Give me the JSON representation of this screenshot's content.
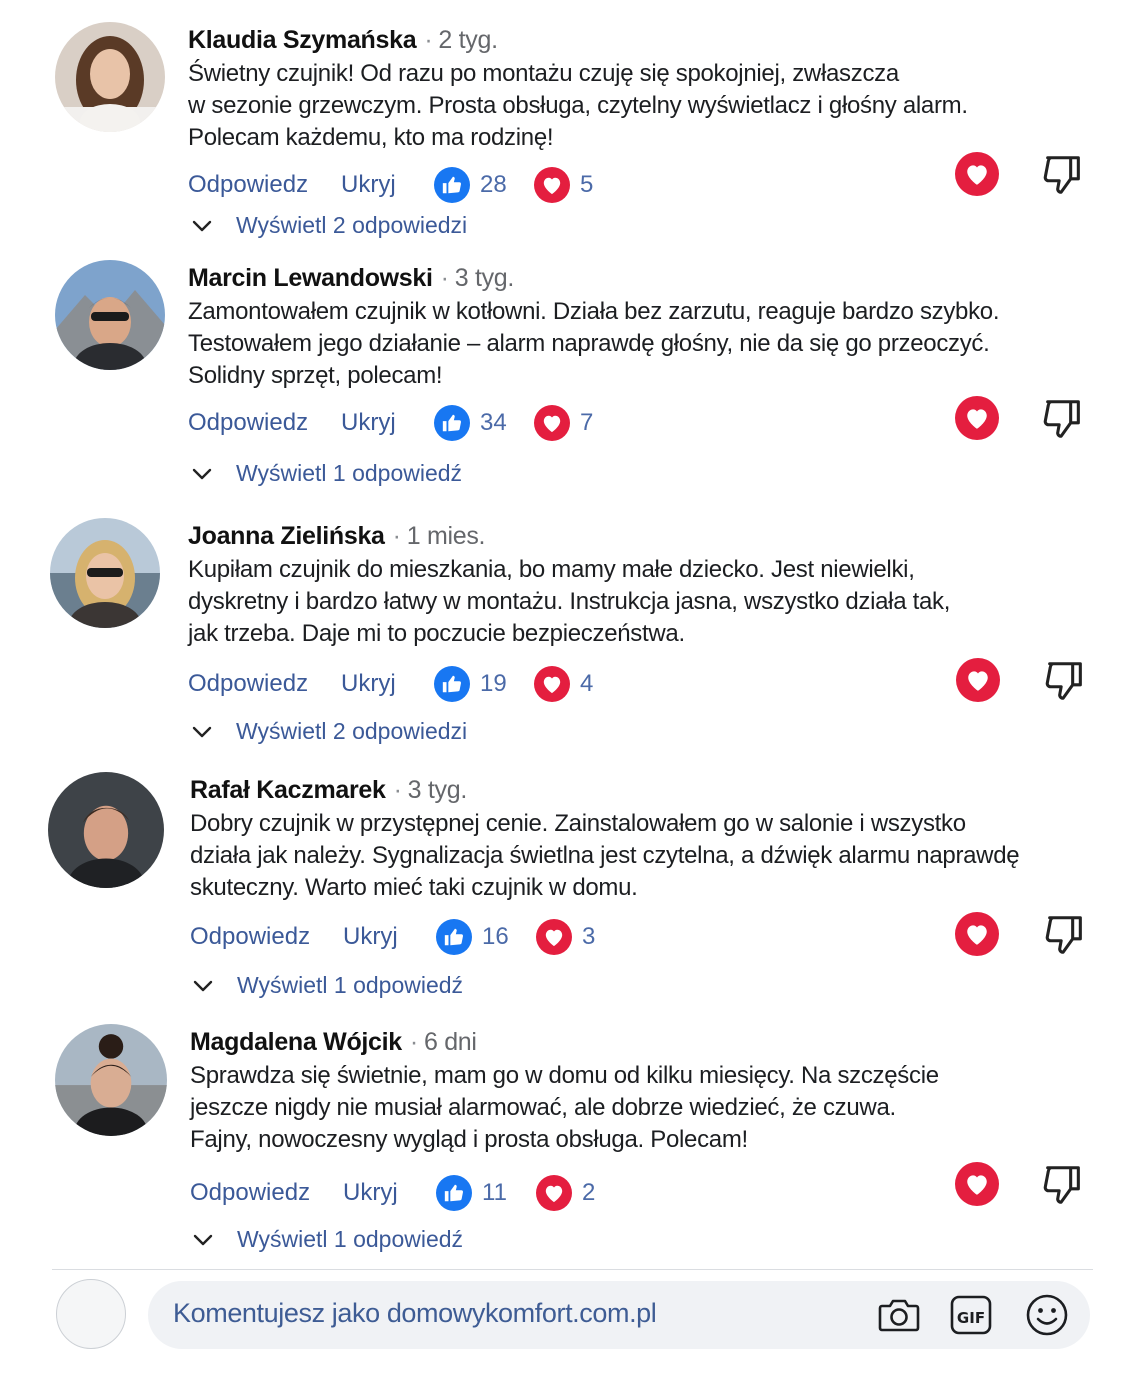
{
  "comments": [
    {
      "author": "Klaudia Szymańska",
      "time": "2 tyg.",
      "lines": [
        "Świetny czujnik! Od razu po montażu czuję się spokojniej, zwłaszcza",
        "w sezonie grzewczym. Prosta obsługa, czytelny wyświetlacz i głośny alarm.",
        "Polecam każdemu, kto ma rodzinę!"
      ],
      "reply_label": "Odpowiedz",
      "hide_label": "Ukryj",
      "likes": "28",
      "hearts": "5",
      "view_replies": "Wyświetl 2 odpowiedzi"
    },
    {
      "author": "Marcin Lewandowski",
      "time": "3 tyg.",
      "lines": [
        "Zamontowałem czujnik w kotłowni. Działa bez zarzutu, reaguje bardzo szybko.",
        "Testowałem jego działanie – alarm naprawdę głośny, nie da się go przeoczyć.",
        "Solidny sprzęt, polecam!"
      ],
      "reply_label": "Odpowiedz",
      "hide_label": "Ukryj",
      "likes": "34",
      "hearts": "7",
      "view_replies": "Wyświetl 1 odpowiedź"
    },
    {
      "author": "Joanna Zielińska",
      "time": "1 mies.",
      "lines": [
        "Kupiłam czujnik do mieszkania, bo mamy małe dziecko. Jest niewielki,",
        "dyskretny i bardzo łatwy w montażu. Instrukcja jasna, wszystko działa tak,",
        "jak trzeba. Daje mi to poczucie bezpieczeństwa."
      ],
      "reply_label": "Odpowiedz",
      "hide_label": "Ukryj",
      "likes": "19",
      "hearts": "4",
      "view_replies": "Wyświetl 2 odpowiedzi"
    },
    {
      "author": "Rafał Kaczmarek",
      "time": "3 tyg.",
      "lines": [
        "Dobry czujnik w przystępnej cenie. Zainstalowałem go w salonie i wszystko",
        "działa jak należy. Sygnalizacja świetlna jest czytelna, a dźwięk alarmu naprawdę",
        "skuteczny. Warto mieć taki czujnik w domu."
      ],
      "reply_label": "Odpowiedz",
      "hide_label": "Ukryj",
      "likes": "16",
      "hearts": "3",
      "view_replies": "Wyświetl 1 odpowiedź"
    },
    {
      "author": "Magdalena Wójcik",
      "time": "6 dni",
      "lines": [
        "Sprawdza się świetnie, mam go w domu od kilku miesięcy. Na szczęście",
        "jeszcze nigdy nie musiał alarmować, ale dobrze wiedzieć, że czuwa.",
        "Fajny, nowoczesny wygląd i prosta obsługa. Polecam!"
      ],
      "reply_label": "Odpowiedz",
      "hide_label": "Ukryj",
      "likes": "11",
      "hearts": "2",
      "view_replies": "Wyświetl 1 odpowiedź"
    }
  ],
  "composer": {
    "text": "Komentujesz jako domowykomfort.com.pl",
    "icons": [
      "camera-icon",
      "gif-icon",
      "emoji-icon"
    ]
  },
  "colors": {
    "link": "#3b5998",
    "like": "#1877f2",
    "heart": "#e41e3f"
  }
}
